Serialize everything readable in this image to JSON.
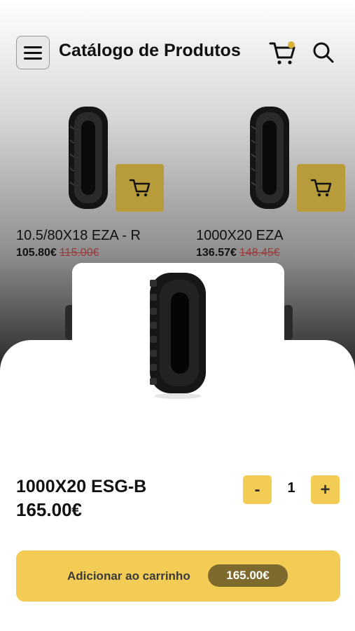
{
  "header": {
    "title": "Catálogo de Produtos",
    "cart_badge_color": "#d9b23a"
  },
  "products": [
    {
      "name": "10.5/80X18 EZA - R",
      "price": "105.80€",
      "old_price": "115.00€"
    },
    {
      "name": "1000X20 EZA",
      "price": "136.57€",
      "old_price": "148.45€"
    }
  ],
  "detail": {
    "name": "1000X20 ESG-B",
    "price": "165.00€",
    "quantity": "1",
    "minus_label": "-",
    "plus_label": "+",
    "add_label": "Adicionar ao carrinho",
    "add_price": "165.00€"
  },
  "colors": {
    "accent": "#f3cc55",
    "accent_dark": "#7d6a2c",
    "card_button": "#b89c3c",
    "old_price": "#9b3a3a"
  },
  "icons": [
    "menu-icon",
    "cart-icon",
    "search-icon",
    "add-to-cart-icon",
    "tire-image"
  ]
}
